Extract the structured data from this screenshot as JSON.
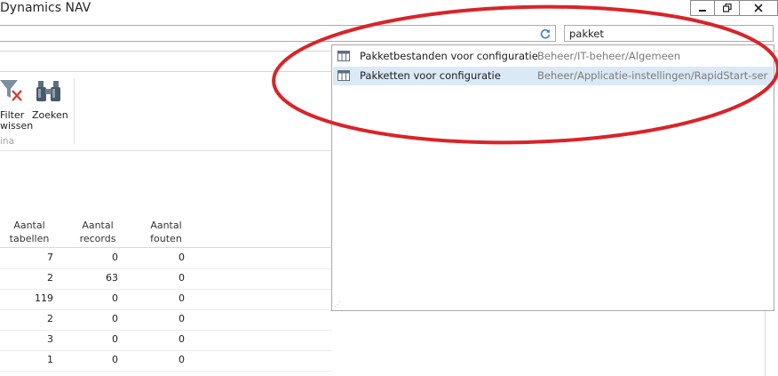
{
  "window": {
    "title": "Dynamics NAV"
  },
  "search": {
    "value": "pakket"
  },
  "ribbon": {
    "filter_label_line1": "Filter",
    "filter_label_line2": "wissen",
    "find_label": "Zoeken",
    "group_label": "ina"
  },
  "table": {
    "headers": [
      {
        "line1": "Aantal",
        "line2": "tabellen"
      },
      {
        "line1": "Aantal",
        "line2": "records"
      },
      {
        "line1": "Aantal",
        "line2": "fouten"
      }
    ],
    "rows": [
      [
        "7",
        "0",
        "0"
      ],
      [
        "2",
        "63",
        "0"
      ],
      [
        "119",
        "0",
        "0"
      ],
      [
        "2",
        "0",
        "0"
      ],
      [
        "3",
        "0",
        "0"
      ],
      [
        "1",
        "0",
        "0"
      ]
    ]
  },
  "suggestions": [
    {
      "name": "Pakketbestanden voor configuratie",
      "path": "Beheer/IT-beheer/Algemeen",
      "selected": false
    },
    {
      "name": "Pakketten voor configuratie",
      "path": "Beheer/Applicatie-instellingen/RapidStart-servi...",
      "selected": true
    }
  ],
  "colors": {
    "annotation": "#d9232a",
    "selection": "#dbe9f6"
  }
}
